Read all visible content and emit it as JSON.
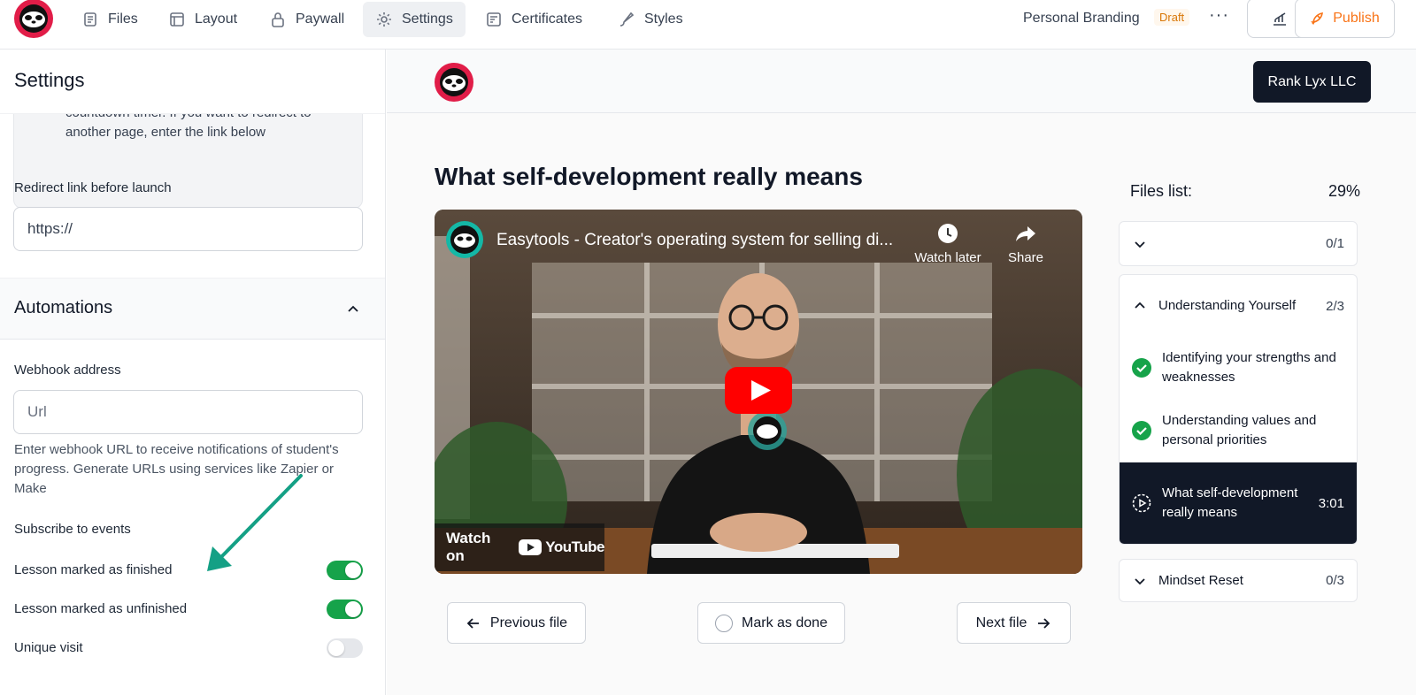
{
  "topbar": {
    "nav": [
      {
        "label": "Files",
        "icon": "files-icon"
      },
      {
        "label": "Layout",
        "icon": "layout-icon"
      },
      {
        "label": "Paywall",
        "icon": "lock-icon"
      },
      {
        "label": "Settings",
        "icon": "gear-icon",
        "active": true
      },
      {
        "label": "Certificates",
        "icon": "certificate-icon"
      },
      {
        "label": "Styles",
        "icon": "brush-icon"
      }
    ],
    "project_name": "Personal Branding",
    "status_badge": "Draft",
    "more": "···",
    "publish_label": "Publish"
  },
  "left": {
    "title": "Settings",
    "info_text_lines": [
      "countdown timer. If you want to redirect to",
      "another page, enter the link below"
    ],
    "redirect_label": "Redirect link before launch",
    "redirect_value": "https://",
    "automations_title": "Automations",
    "webhook_label": "Webhook address",
    "webhook_placeholder": "Url",
    "webhook_help": "Enter webhook URL to receive notifications of student's progress. Generate URLs using services like Zapier or Make",
    "subscribe_label": "Subscribe to events",
    "events": [
      {
        "label": "Lesson marked as finished",
        "on": true
      },
      {
        "label": "Lesson marked as unfinished",
        "on": true
      },
      {
        "label": "Unique visit",
        "on": false
      }
    ]
  },
  "preview": {
    "brand_button": "Rank Lyx LLC",
    "lesson_title": "What self-development really means",
    "video": {
      "title": "Easytools - Creator's operating system for selling di...",
      "watch_later": "Watch later",
      "share": "Share",
      "watch_on": "Watch on",
      "youtube": "YouTube"
    },
    "prev_label": "Previous file",
    "mark_done_label": "Mark as done",
    "next_label": "Next file",
    "files_list_label": "Files list:",
    "files_progress": "29%",
    "modules": [
      {
        "title": "",
        "count": "0/1",
        "expanded": false
      },
      {
        "title": "Understanding Yourself",
        "count": "2/3",
        "expanded": true,
        "lessons": [
          {
            "title": "Identifying your strengths and weaknesses",
            "done": true
          },
          {
            "title": "Understanding values and personal priorities",
            "done": true
          },
          {
            "title": "What self-development really means",
            "duration": "3:01",
            "active": true
          }
        ]
      },
      {
        "title": "Mindset Reset",
        "count": "0/3",
        "expanded": false
      }
    ]
  }
}
